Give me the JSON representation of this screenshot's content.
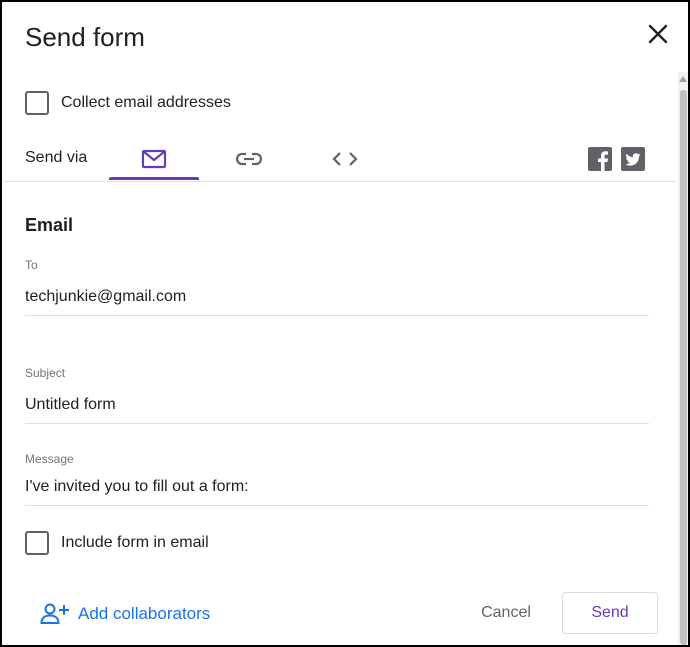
{
  "dialog": {
    "title": "Send form",
    "close_icon": "close-icon"
  },
  "collect_email": {
    "label": "Collect email addresses",
    "checked": false
  },
  "send_via": {
    "label": "Send via",
    "tabs": [
      {
        "name": "email",
        "icon": "mail-icon",
        "selected": true
      },
      {
        "name": "link",
        "icon": "link-icon",
        "selected": false
      },
      {
        "name": "embed",
        "icon": "code-icon",
        "selected": false
      }
    ],
    "social": [
      {
        "name": "facebook",
        "icon": "facebook-icon"
      },
      {
        "name": "twitter",
        "icon": "twitter-icon"
      }
    ]
  },
  "email": {
    "section_title": "Email",
    "to_label": "To",
    "to_value": "techjunkie@gmail.com",
    "subject_label": "Subject",
    "subject_value": "Untitled form",
    "message_label": "Message",
    "message_value": "I've invited you to fill out a form:",
    "include_form_label": "Include form in email",
    "include_form_checked": false
  },
  "footer": {
    "add_collaborators": "Add collaborators",
    "cancel": "Cancel",
    "send": "Send"
  },
  "colors": {
    "accent": "#673ab7",
    "link_blue": "#1a73e8",
    "text": "#202124",
    "muted": "#70757a"
  }
}
